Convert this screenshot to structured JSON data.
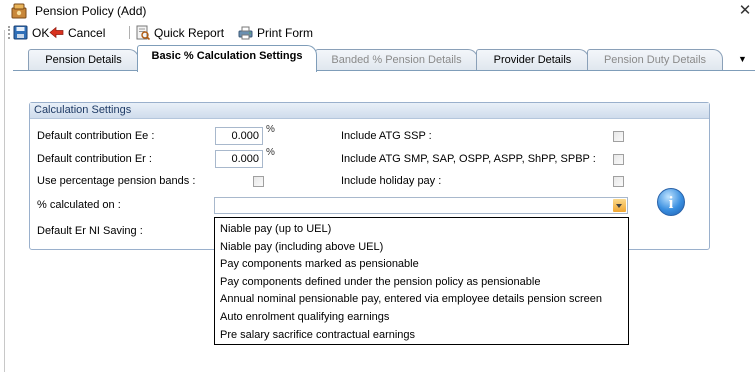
{
  "window": {
    "title": "Pension Policy (Add)",
    "close_glyph": "✕"
  },
  "toolbar": {
    "ok_label": "OK",
    "cancel_label": "Cancel",
    "quick_report_label": "Quick Report",
    "print_form_label": "Print Form"
  },
  "tabs": [
    {
      "label": "Pension Details",
      "state": "normal"
    },
    {
      "label": "Basic % Calculation Settings",
      "state": "active"
    },
    {
      "label": "Banded % Pension Details",
      "state": "disabled"
    },
    {
      "label": "Provider Details",
      "state": "normal"
    },
    {
      "label": "Pension Duty Details",
      "state": "disabled"
    }
  ],
  "tab_overflow_glyph": "▼",
  "group": {
    "title": "Calculation Settings",
    "default_contribution_ee_label": "Default contribution  Ee :",
    "default_contribution_ee_value": "0.000",
    "default_contribution_er_label": "Default contribution  Er :",
    "default_contribution_er_value": "0.000",
    "percent_symbol": "%",
    "use_percentage_bands_label": "Use percentage pension bands :",
    "calculated_on_label": "% calculated on :",
    "calculated_on_value": "",
    "default_er_ni_saving_label": "Default Er NI Saving :",
    "include_atg_ssp_label": "Include ATG SSP :",
    "include_atg_smp_label": "Include ATG SMP, SAP, OSPP, ASPP, ShPP, SPBP :",
    "include_holiday_pay_label": "Include holiday pay :",
    "info_glyph": "i"
  },
  "dropdown_options": [
    "Niable pay (up to UEL)",
    "Niable pay (including above UEL)",
    "Pay components marked as pensionable",
    "Pay components defined under the pension policy as pensionable",
    "Annual nominal pensionable pay, entered via employee details pension screen",
    "Auto enrolment qualifying earnings",
    "Pre salary sacrifice contractual earnings"
  ],
  "colors": {
    "accent_blue": "#1f5fb0",
    "group_header_text": "#1f3b66",
    "combo_button": "#f0a632"
  }
}
